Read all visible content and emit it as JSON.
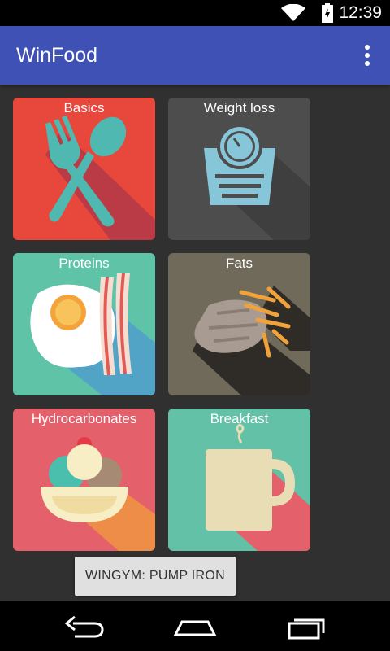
{
  "status_bar": {
    "time": "12:39"
  },
  "app_bar": {
    "title": "WinFood"
  },
  "tiles": [
    {
      "label": "Basics",
      "color": "#e8473c"
    },
    {
      "label": "Weight loss",
      "color": "#4d4d4d"
    },
    {
      "label": "Proteins",
      "color": "#5fc3a8"
    },
    {
      "label": "Fats",
      "color": "#6f6a5a"
    },
    {
      "label": "Hydrocarbonates",
      "color": "#e4606a"
    },
    {
      "label": "Breakfast",
      "color": "#62c1a6"
    }
  ],
  "toast": {
    "text": "WINGYM: PUMP IRON"
  },
  "icons": [
    "wifi-icon",
    "battery-icon",
    "overflow-menu-icon",
    "back-icon",
    "home-icon",
    "recents-icon"
  ]
}
